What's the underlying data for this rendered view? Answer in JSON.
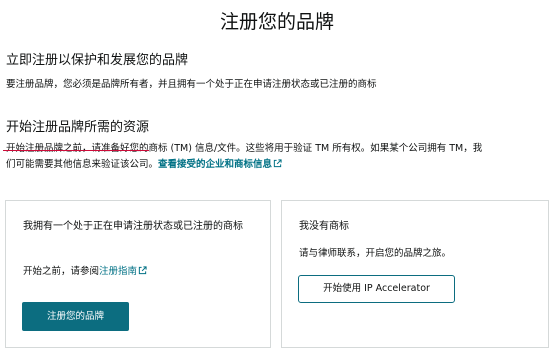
{
  "page": {
    "title": "注册您的品牌"
  },
  "protect_section": {
    "heading": "立即注册以保护和发展您的品牌",
    "text": "要注册品牌，您必须是品牌所有者，并且拥有一个处于正在申请注册状态或已注册的商标"
  },
  "resources_section": {
    "heading": "开始注册品牌所需的资源",
    "text_strike": "开始注册品牌之前，请准备好您的",
    "text_line1_rest": "商标 (TM) 信息/文件。这些将用于验证 TM 所有权。如果某个公司拥有 TM，我",
    "text_line2": "们可能需要其他信息来验证该公司。",
    "link_label": "查看接受的企业和商标信息",
    "link_icon": "external-link-icon"
  },
  "card_has_trademark": {
    "title": "我拥有一个处于正在申请注册状态或已注册的商标",
    "text_prefix": "开始之前，请参阅",
    "link_label": "注册指南",
    "link_icon": "external-link-icon",
    "button_label": "注册您的品牌"
  },
  "card_no_trademark": {
    "title": "我没有商标",
    "text": "请与律师联系，开启您的品牌之旅。",
    "button_label": "开始使用 IP Accelerator"
  },
  "colors": {
    "accent": "#007185",
    "button_primary": "#0c6d80",
    "text": "#0f1111",
    "border": "#d5d9d9",
    "strike": "#cc0c39"
  }
}
